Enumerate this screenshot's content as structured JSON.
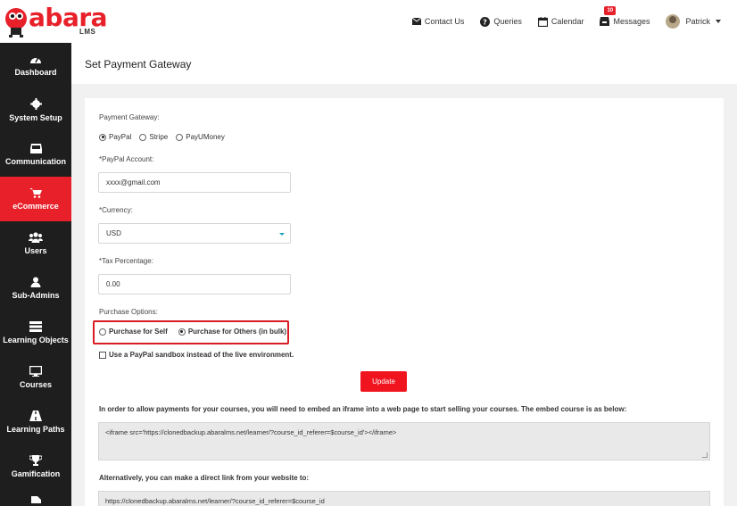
{
  "brand": {
    "name": "abara",
    "sub": "LMS"
  },
  "topnav": {
    "contact": "Contact Us",
    "queries": "Queries",
    "calendar": "Calendar",
    "messages": "Messages",
    "messages_count": "10",
    "user": "Patrick"
  },
  "sidebar": {
    "items": [
      {
        "label": "Dashboard"
      },
      {
        "label": "System Setup"
      },
      {
        "label": "Communication"
      },
      {
        "label": "eCommerce"
      },
      {
        "label": "Users"
      },
      {
        "label": "Sub-Admins"
      },
      {
        "label": "Learning Objects"
      },
      {
        "label": "Courses"
      },
      {
        "label": "Learning Paths"
      },
      {
        "label": "Gamification"
      }
    ]
  },
  "page": {
    "title": "Set Payment Gateway"
  },
  "form": {
    "gateway_label": "Payment Gateway:",
    "gateways": [
      "PayPal",
      "Stripe",
      "PayUMoney"
    ],
    "gateway_selected": "PayPal",
    "account_label": "*PayPal Account:",
    "account_value": "xxxx@gmail.com",
    "currency_label": "*Currency:",
    "currency_value": "USD",
    "tax_label": "*Tax Percentage:",
    "tax_value": "0.00",
    "purchase_label": "Purchase Options:",
    "purchase_self": "Purchase for Self",
    "purchase_others": "Purchase for Others (in bulk)",
    "purchase_selected": "Purchase for Others (in bulk)",
    "sandbox_label": "Use a PayPal sandbox instead of the live environment.",
    "update_button": "Update",
    "embed_desc": "In order to allow payments for your courses, you will need to embed an iframe into a web page to start selling your courses. The embed course is as below:",
    "embed_code": "<iframe src='https://clonedbackup.abaralms.net/learner/?course_id_referer=$course_id'></iframe>",
    "direct_desc": "Alternatively, you can make a direct link from your website to:",
    "direct_link": "https://clonedbackup.abaralms.net/learner/?course_id_referer=$course_id"
  },
  "colors": {
    "brand_red": "#e8202a",
    "sidebar_bg": "#1e1e1e",
    "highlight_box": "#d91b24"
  }
}
